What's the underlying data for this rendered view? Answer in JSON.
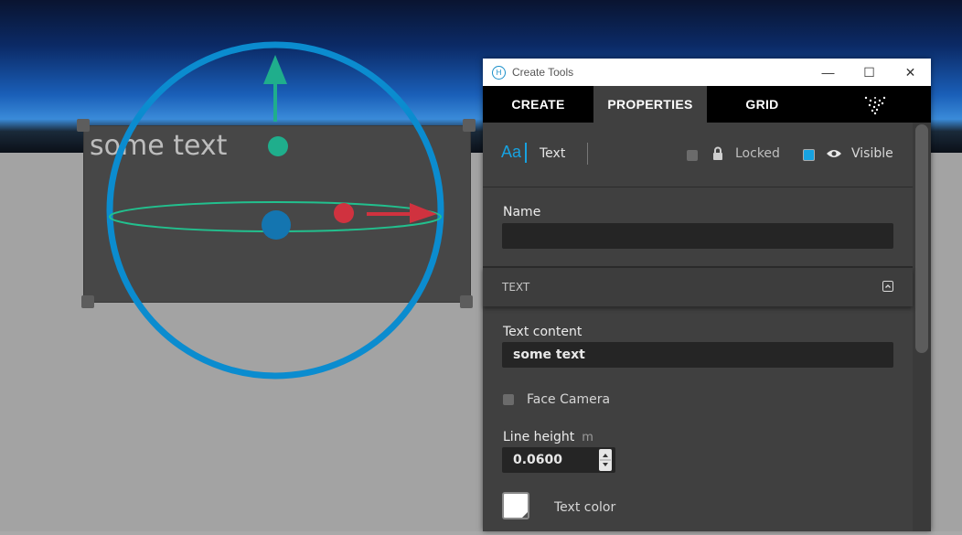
{
  "viewport": {
    "entity_text": "some text"
  },
  "window": {
    "title": "Create Tools",
    "minimize": "—",
    "maximize": "☐",
    "close": "✕"
  },
  "tabs": [
    {
      "label": "CREATE"
    },
    {
      "label": "PROPERTIES"
    },
    {
      "label": "GRID"
    }
  ],
  "entity_type": {
    "icon": "Aa",
    "label": "Text"
  },
  "toggles": {
    "locked_label": "Locked",
    "locked": false,
    "visible_label": "Visible",
    "visible": true
  },
  "name": {
    "label": "Name",
    "value": ""
  },
  "section": {
    "title": "TEXT"
  },
  "text_content": {
    "label": "Text content",
    "value": "some text"
  },
  "face_camera": {
    "label": "Face Camera",
    "checked": false
  },
  "line_height": {
    "label": "Line height",
    "unit": "m",
    "value": "0.0600"
  },
  "text_color": {
    "label": "Text color",
    "value": "#ffffff"
  },
  "colors": {
    "accent": "#17a2e0",
    "gizmo_ring": "#0b8ccf",
    "y_axis": "#1fae8c",
    "x_axis": "#d0323f"
  }
}
